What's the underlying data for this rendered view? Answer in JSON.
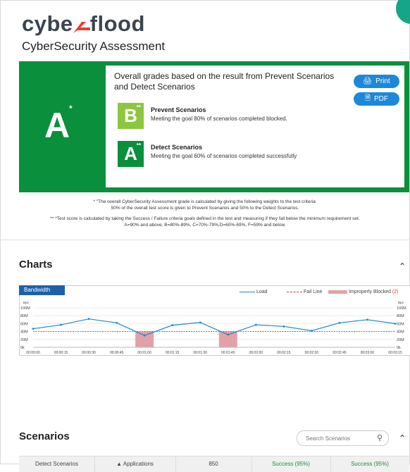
{
  "brand": {
    "logo": "cybe",
    "logo_flood": "flood",
    "subtitle": "CyberSecurity Assessment"
  },
  "grades": {
    "overall_grade": "A",
    "overall_grade_mark": "*",
    "overall_text": "Overall grades based on the result from Prevent Scenarios and Detect Scenarios",
    "print_label": "Print",
    "pdf_label": "PDF",
    "prevent": {
      "grade": "B",
      "mark": "**",
      "title": "Prevent Scenarios",
      "desc": "Meeting the goal 80% of scenarios completed blocked.",
      "color": "#8dc63f"
    },
    "detect": {
      "grade": "A",
      "mark": "**",
      "title": "Detect Scenarios",
      "desc": "Meeting the goal 60% of scenarios completed successfully",
      "color": "#0a8f3c"
    }
  },
  "footnotes": {
    "line1": "* \"The overall CyberSecurity Assessment grade is calculated by giving the following weights to the test criteria:",
    "line2": "50% of the overall test score is given to Prevent Scenarios and 50% to the Detect Scenarios.",
    "line3": "** *Test score is calculated by taking the Success / Failure criteria goals defined in the test and measuring if they fall below the minimum requirement set.",
    "line4": "A=90% and above, B=80%-89%, C=70%-79%,D=60%-69%, F=59% and below."
  },
  "charts": {
    "title": "Charts",
    "collapse_icon": "chevron-up-icon",
    "tab": "Bandwidth",
    "legend": {
      "load": "Load",
      "fail": "Fail Line",
      "blocked": "Improperly Blocked",
      "blocked_count": "(2)"
    }
  },
  "chart_data": {
    "type": "line",
    "x": [
      "00:00:00",
      "00:00:15",
      "00:00:30",
      "00:00:45",
      "00:01:00",
      "00:01:15",
      "00:01:30",
      "00:01:45",
      "00:02:00",
      "00:02:15",
      "00:02:30",
      "00:02:45",
      "00:03:00",
      "00:03:15"
    ],
    "series": [
      {
        "name": "Load",
        "values": [
          47,
          57,
          72,
          62,
          30,
          56,
          63,
          32,
          57,
          53,
          42,
          62,
          70,
          60
        ],
        "color": "#1e88d8"
      },
      {
        "name": "Fail Line",
        "values": [
          40,
          40,
          40,
          40,
          40,
          40,
          40,
          40,
          40,
          40,
          40,
          40,
          40,
          40
        ],
        "color": "#d9363e"
      }
    ],
    "improperly_blocked": [
      "00:01:00",
      "00:01:45"
    ],
    "ylabel": "Bps",
    "y_ticks": [
      "0k",
      "20M",
      "40M",
      "60M",
      "80M",
      "100M"
    ],
    "ylim": [
      0,
      100
    ],
    "grid": true,
    "legend_position": "top-right"
  },
  "scenarios": {
    "title": "Scenarios",
    "search_placeholder": "Search Scenarios",
    "row": {
      "name": "Detect Scenarios",
      "type": "Applications",
      "count": "850",
      "result1": "Success (95%)",
      "result2": "Success (95%)"
    }
  }
}
